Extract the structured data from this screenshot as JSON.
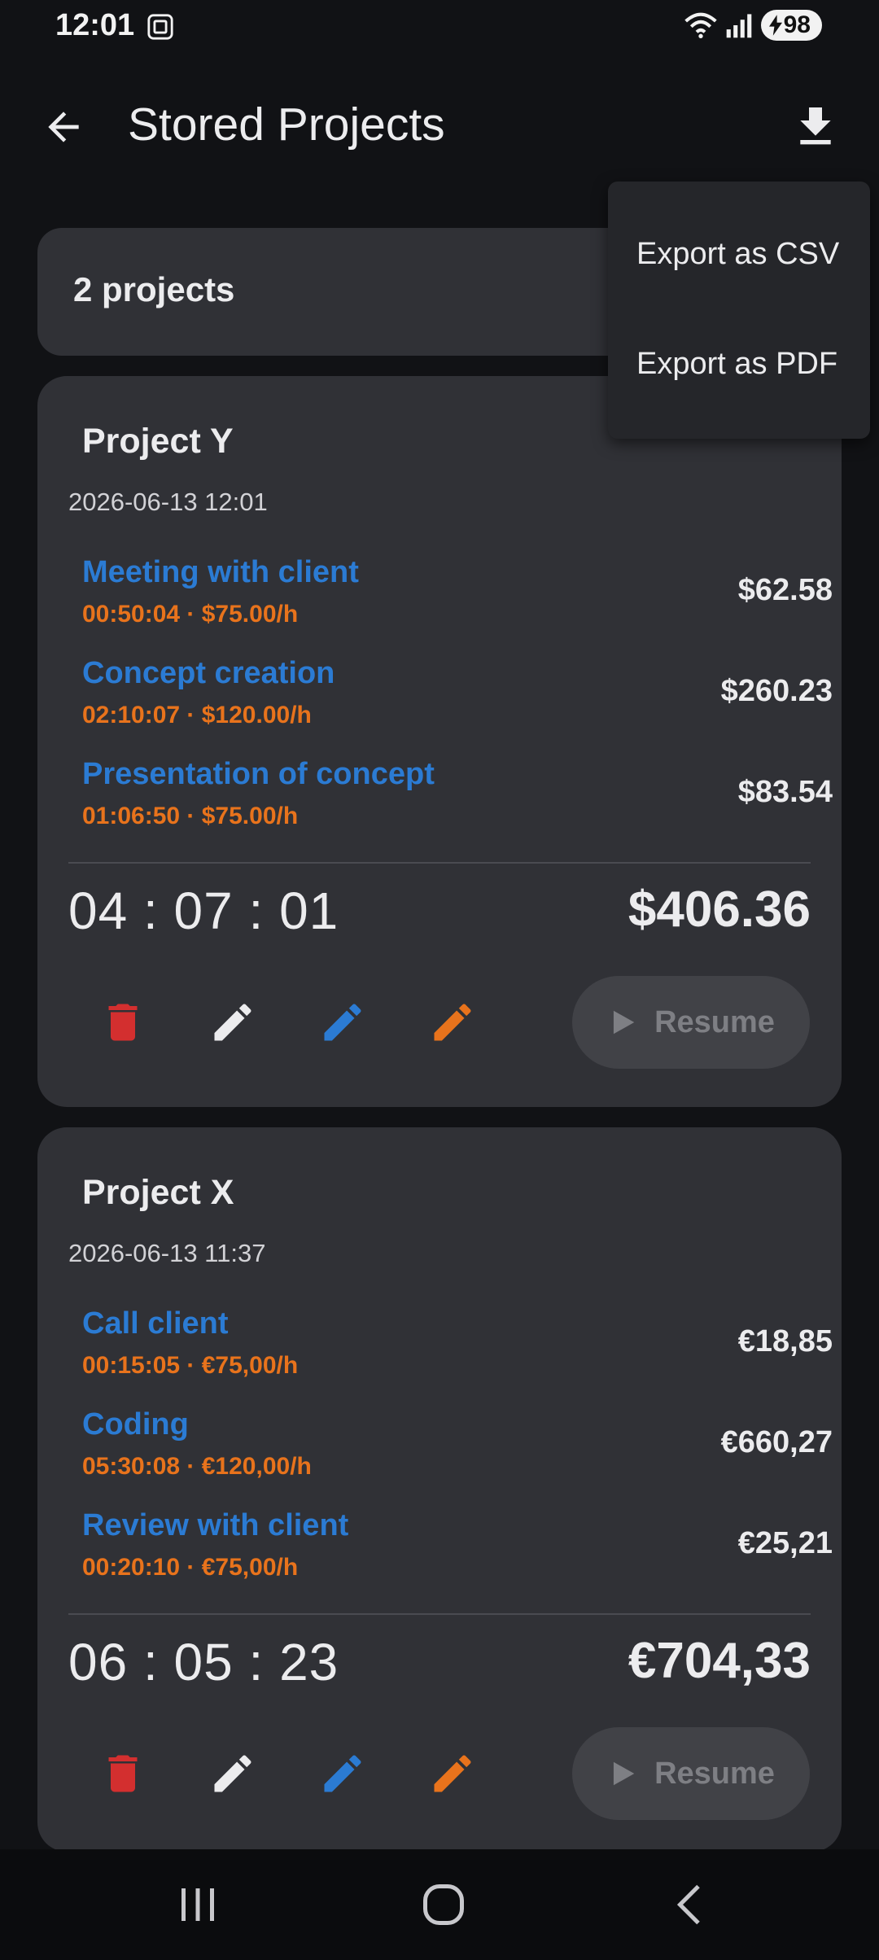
{
  "status_bar": {
    "time": "12:01",
    "battery": "98"
  },
  "app_bar": {
    "title": "Stored Projects"
  },
  "header": {
    "count_label": "2 projects"
  },
  "export_menu": {
    "items": [
      "Export as CSV",
      "Export as PDF"
    ]
  },
  "projects": [
    {
      "name": "Project Y",
      "date": "2026-06-13 12:01",
      "tasks": [
        {
          "name": "Meeting with client",
          "meta": "00:50:04 · $75.00/h",
          "amount": "$62.58"
        },
        {
          "name": "Concept creation",
          "meta": "02:10:07 · $120.00/h",
          "amount": "$260.23"
        },
        {
          "name": "Presentation of concept",
          "meta": "01:06:50 · $75.00/h",
          "amount": "$83.54"
        }
      ],
      "elapsed": "04 : 07 : 01",
      "total": "$406.36",
      "resume_label": "Resume"
    },
    {
      "name": "Project X",
      "date": "2026-06-13 11:37",
      "tasks": [
        {
          "name": "Call client",
          "meta": "00:15:05 · €75,00/h",
          "amount": "€18,85"
        },
        {
          "name": "Coding",
          "meta": "05:30:08 · €120,00/h",
          "amount": "€660,27"
        },
        {
          "name": "Review with client",
          "meta": "00:20:10 · €75,00/h",
          "amount": "€25,21"
        }
      ],
      "elapsed": "06 : 05 : 23",
      "total": "€704,33",
      "resume_label": "Resume"
    }
  ],
  "colors": {
    "background": "#111215",
    "card": "#303136",
    "task_name": "#2B7BD3",
    "task_meta": "#E8731C",
    "delete_icon": "#D32F2F",
    "edit_white": "#ECECEE",
    "edit_blue": "#2B7BD3",
    "edit_orange": "#E8731C"
  },
  "icons": {
    "back": "arrow-left-icon",
    "download": "download-icon",
    "delete": "trash-icon",
    "edit": "pencil-icon",
    "resume": "play-icon"
  }
}
